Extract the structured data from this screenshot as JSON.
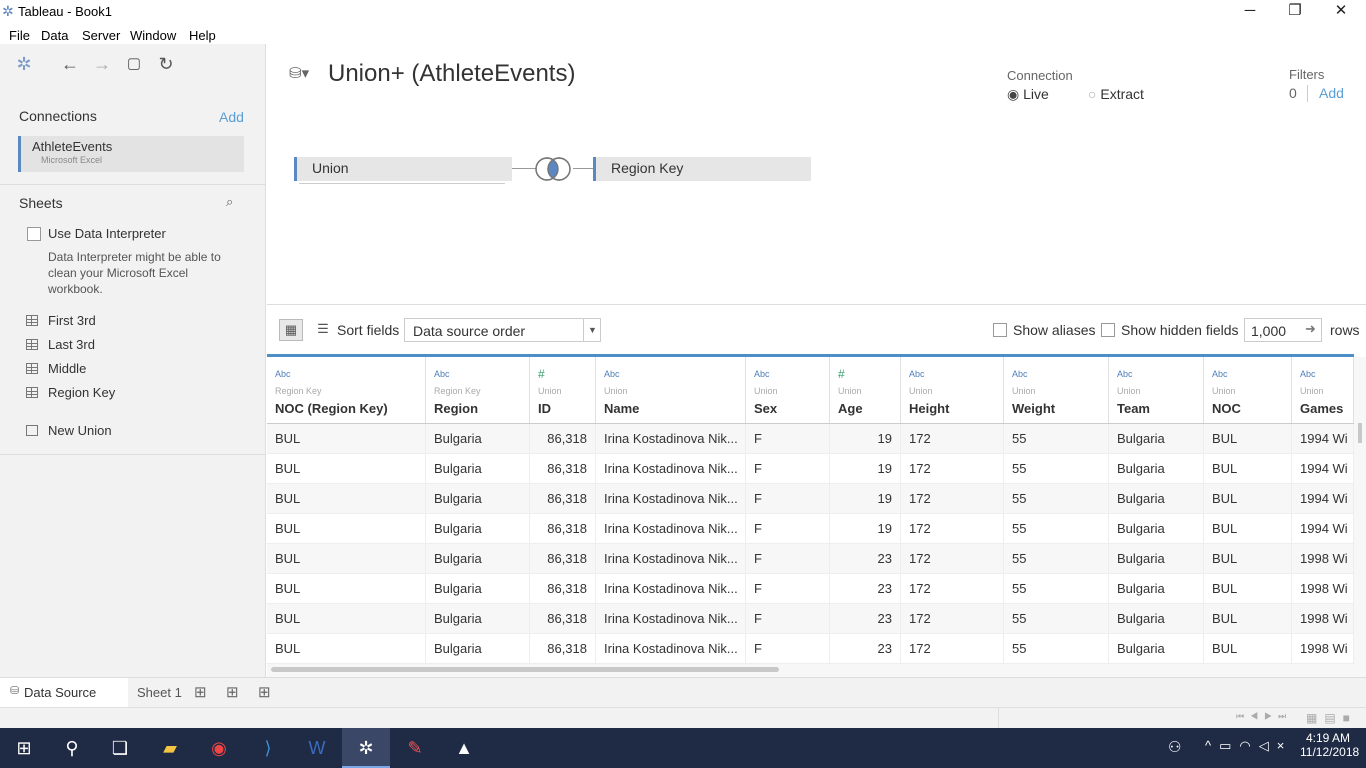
{
  "window": {
    "title": "Tableau - Book1"
  },
  "menu": [
    "File",
    "Data",
    "Server",
    "Window",
    "Help"
  ],
  "connections": {
    "title": "Connections",
    "add_label": "Add",
    "name": "AthleteEvents",
    "type": "Microsoft Excel"
  },
  "sheets": {
    "title": "Sheets",
    "interpreter_label": "Use Data Interpreter",
    "interpreter_note": [
      "Data Interpreter might be able to",
      "clean your Microsoft Excel",
      "workbook."
    ],
    "items": [
      "First 3rd",
      "Last 3rd",
      "Middle",
      "Region Key"
    ],
    "new_union": "New Union"
  },
  "datasource": {
    "title": "Union+ (AthleteEvents)"
  },
  "connection_mode": {
    "label": "Connection",
    "live": "Live",
    "extract": "Extract",
    "selected": "Live"
  },
  "filters": {
    "label": "Filters",
    "count": "0",
    "add_label": "Add"
  },
  "join": {
    "left_table": "Union",
    "right_table": "Region Key",
    "type": "inner"
  },
  "grid_toolbar": {
    "sort_label": "Sort fields",
    "sort_value": "Data source order",
    "show_aliases": "Show aliases",
    "show_hidden": "Show hidden fields",
    "rows_value": "1,000",
    "rows_label": "rows"
  },
  "columns": [
    {
      "type": "Abc",
      "source": "Region Key",
      "name": "NOC (Region Key)"
    },
    {
      "type": "Abc",
      "source": "Region Key",
      "name": "Region"
    },
    {
      "type": "#",
      "source": "Union",
      "name": "ID"
    },
    {
      "type": "Abc",
      "source": "Union",
      "name": "Name"
    },
    {
      "type": "Abc",
      "source": "Union",
      "name": "Sex"
    },
    {
      "type": "#",
      "source": "Union",
      "name": "Age"
    },
    {
      "type": "Abc",
      "source": "Union",
      "name": "Height"
    },
    {
      "type": "Abc",
      "source": "Union",
      "name": "Weight"
    },
    {
      "type": "Abc",
      "source": "Union",
      "name": "Team"
    },
    {
      "type": "Abc",
      "source": "Union",
      "name": "NOC"
    },
    {
      "type": "Abc",
      "source": "Union",
      "name": "Games"
    }
  ],
  "rows": [
    [
      "BUL",
      "Bulgaria",
      "86,318",
      "Irina Kostadinova Nik...",
      "F",
      "19",
      "172",
      "55",
      "Bulgaria",
      "BUL",
      "1994 Wi"
    ],
    [
      "BUL",
      "Bulgaria",
      "86,318",
      "Irina Kostadinova Nik...",
      "F",
      "19",
      "172",
      "55",
      "Bulgaria",
      "BUL",
      "1994 Wi"
    ],
    [
      "BUL",
      "Bulgaria",
      "86,318",
      "Irina Kostadinova Nik...",
      "F",
      "19",
      "172",
      "55",
      "Bulgaria",
      "BUL",
      "1994 Wi"
    ],
    [
      "BUL",
      "Bulgaria",
      "86,318",
      "Irina Kostadinova Nik...",
      "F",
      "19",
      "172",
      "55",
      "Bulgaria",
      "BUL",
      "1994 Wi"
    ],
    [
      "BUL",
      "Bulgaria",
      "86,318",
      "Irina Kostadinova Nik...",
      "F",
      "23",
      "172",
      "55",
      "Bulgaria",
      "BUL",
      "1998 Wi"
    ],
    [
      "BUL",
      "Bulgaria",
      "86,318",
      "Irina Kostadinova Nik...",
      "F",
      "23",
      "172",
      "55",
      "Bulgaria",
      "BUL",
      "1998 Wi"
    ],
    [
      "BUL",
      "Bulgaria",
      "86,318",
      "Irina Kostadinova Nik...",
      "F",
      "23",
      "172",
      "55",
      "Bulgaria",
      "BUL",
      "1998 Wi"
    ],
    [
      "BUL",
      "Bulgaria",
      "86,318",
      "Irina Kostadinova Nik...",
      "F",
      "23",
      "172",
      "55",
      "Bulgaria",
      "BUL",
      "1998 Wi"
    ]
  ],
  "tabs": {
    "datasource": "Data Source",
    "sheet1": "Sheet 1"
  },
  "taskbar": {
    "time": "4:19 AM",
    "date": "11/12/2018"
  }
}
